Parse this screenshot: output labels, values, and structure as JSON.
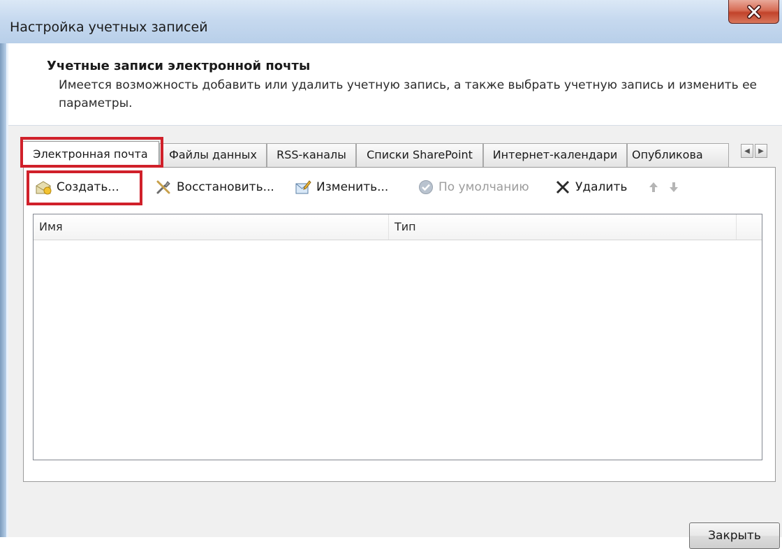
{
  "window": {
    "title": "Настройка учетных записей"
  },
  "header": {
    "title": "Учетные записи электронной почты",
    "description": "Имеется возможность добавить или удалить учетную запись, а также выбрать учетную запись и изменить ее параметры."
  },
  "tabs": [
    {
      "label": "Электронная почта",
      "active": true
    },
    {
      "label": "Файлы данных",
      "active": false
    },
    {
      "label": "RSS-каналы",
      "active": false
    },
    {
      "label": "Списки SharePoint",
      "active": false
    },
    {
      "label": "Интернет-календари",
      "active": false
    },
    {
      "label": "Опубликова",
      "active": false
    }
  ],
  "toolbar": {
    "create": "Создать...",
    "repair": "Восстановить...",
    "change": "Изменить...",
    "default": "По умолчанию",
    "delete": "Удалить"
  },
  "list": {
    "columns": [
      "Имя",
      "Тип"
    ],
    "rows": []
  },
  "footer": {
    "close": "Закрыть"
  },
  "colors": {
    "highlight": "#d0202a",
    "close_button": "#c2432b",
    "titlebar": "#c6d9ef"
  },
  "icons": {
    "create": "new-account-icon",
    "repair": "repair-tools-icon",
    "change": "change-account-icon",
    "default": "check-circle-icon",
    "delete": "delete-x-icon",
    "move_up": "arrow-up-icon",
    "move_down": "arrow-down-icon"
  }
}
